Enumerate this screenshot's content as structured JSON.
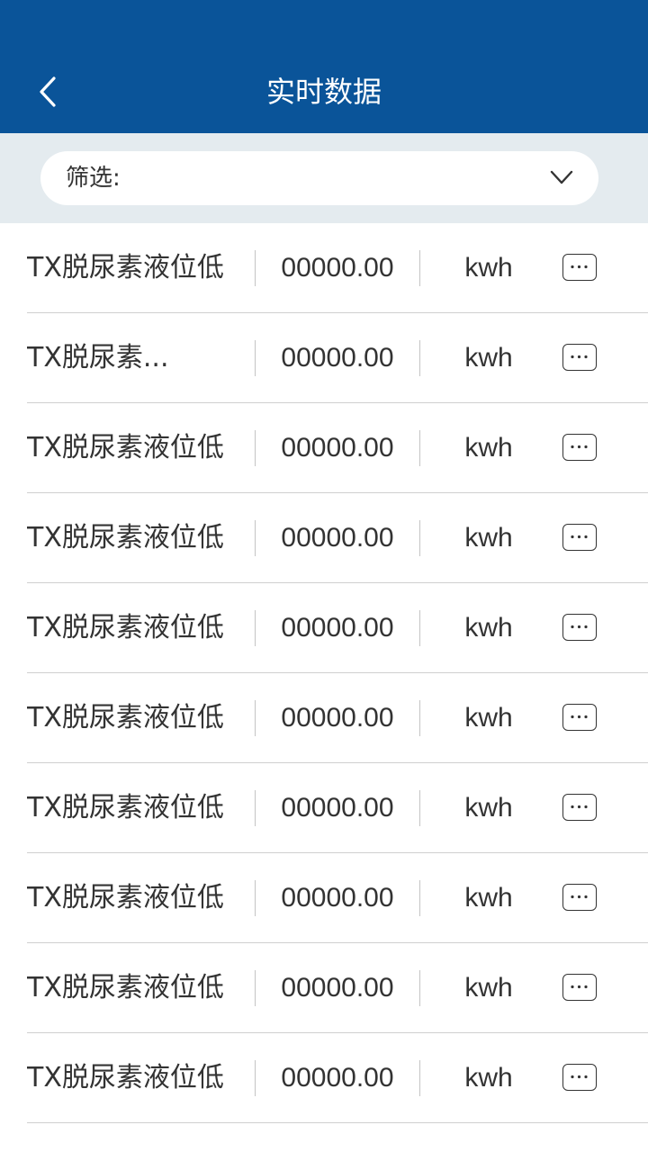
{
  "header": {
    "title": "实时数据",
    "back_icon": "chevron-left-icon",
    "bg_color": "#0a5499"
  },
  "filter": {
    "label": "筛选:",
    "chevron_icon": "chevron-down-icon"
  },
  "rows": [
    {
      "name": "TX脱尿素液位低",
      "value": "00000.00",
      "unit": "kwh"
    },
    {
      "name": "TX脱尿素...",
      "value": "00000.00",
      "unit": "kwh"
    },
    {
      "name": "TX脱尿素液位低",
      "value": "00000.00",
      "unit": "kwh"
    },
    {
      "name": "TX脱尿素液位低",
      "value": "00000.00",
      "unit": "kwh"
    },
    {
      "name": "TX脱尿素液位低",
      "value": "00000.00",
      "unit": "kwh"
    },
    {
      "name": "TX脱尿素液位低",
      "value": "00000.00",
      "unit": "kwh"
    },
    {
      "name": "TX脱尿素液位低",
      "value": "00000.00",
      "unit": "kwh"
    },
    {
      "name": "TX脱尿素液位低",
      "value": "00000.00",
      "unit": "kwh"
    },
    {
      "name": "TX脱尿素液位低",
      "value": "00000.00",
      "unit": "kwh"
    },
    {
      "name": "TX脱尿素液位低",
      "value": "00000.00",
      "unit": "kwh"
    }
  ],
  "more_icon": "more-dots-icon"
}
